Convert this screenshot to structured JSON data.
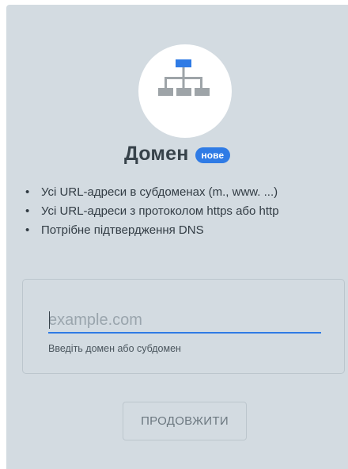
{
  "card": {
    "icon": "network-hierarchy-icon",
    "title": "Домен",
    "badge": "нове",
    "features": [
      {
        "bullet": "•",
        "text": "Усі URL-адреси в субдоменах (m., www. ...)"
      },
      {
        "bullet": "•",
        "text": "Усі URL-адреси з протоколом https або http"
      },
      {
        "bullet": "•",
        "text": "Потрібне підтвердження DNS"
      }
    ],
    "input": {
      "value": "",
      "placeholder": "example.com",
      "helper": "Введіть домен або субдомен"
    },
    "button": "ПРОДОВЖИТИ"
  },
  "colors": {
    "card_background": "#d3dbe1",
    "accent": "#2f7be5",
    "icon_gray": "#9ea4a8",
    "title_text": "#37424a"
  }
}
